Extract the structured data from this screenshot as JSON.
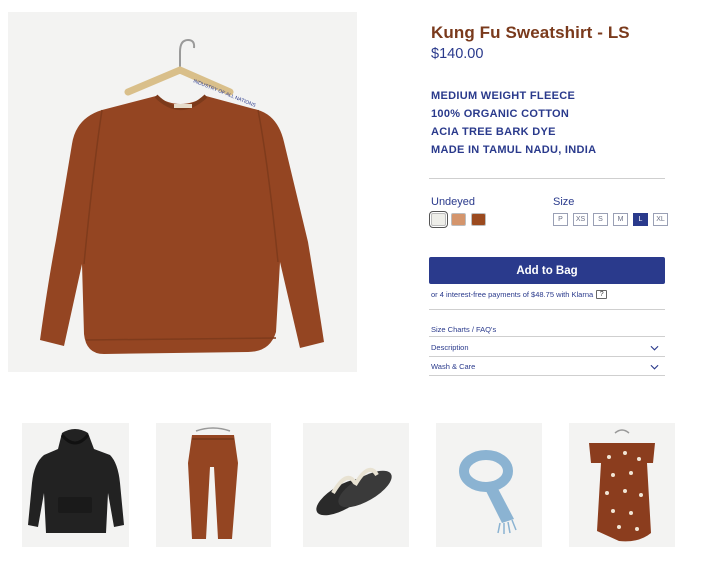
{
  "product": {
    "title": "Kung Fu Sweatshirt - LS",
    "price": "$140.00",
    "features": [
      "MEDIUM WEIGHT FLEECE",
      "100% ORGANIC COTTON",
      "ACIA TREE BARK DYE",
      "MADE IN TAMUL NADU, INDIA"
    ],
    "hanger_text": "INDUSTRY OF ALL NATIONS"
  },
  "options": {
    "color_label": "Undeyed",
    "colors": [
      "#eeeee9",
      "#d4956c",
      "#9b4a1f"
    ],
    "size_label": "Size",
    "sizes": [
      "P",
      "XS",
      "S",
      "M",
      "L",
      "XL"
    ],
    "selected_size": "L"
  },
  "actions": {
    "add_to_bag": "Add to Bag",
    "klarna": "or 4 interest-free payments of $48.75 with Klarna",
    "klarna_help": "?"
  },
  "info": {
    "size_link": "Size Charts / FAQ's",
    "description": "Description",
    "wash_care": "Wash & Care"
  },
  "related": [
    {
      "name": "black-hoodie"
    },
    {
      "name": "rust-pants"
    },
    {
      "name": "sandals"
    },
    {
      "name": "blue-belt"
    },
    {
      "name": "printed-dress"
    }
  ],
  "colors": {
    "accent": "#2a3a8c",
    "title": "#7a3a1c",
    "product": "#944522"
  }
}
